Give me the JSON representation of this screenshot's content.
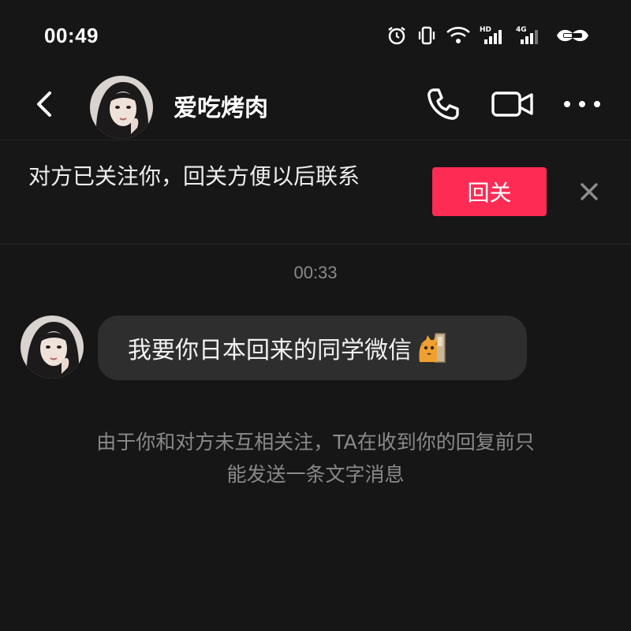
{
  "status": {
    "time": "00:49",
    "icons": [
      "alarm-icon",
      "vibrate-icon",
      "wifi-icon",
      "hd-signal-icon",
      "4g-signal-icon",
      "battery-icon"
    ]
  },
  "header": {
    "contact_name": "爱吃烤肉",
    "back_icon": "chevron-left-icon",
    "call_icon": "phone-icon",
    "video_icon": "video-camera-icon",
    "more_icon": "more-dots-icon"
  },
  "follow_banner": {
    "text": "对方已关注你，回关方便以后联系",
    "button_label": "回关",
    "button_color": "#fe2c55",
    "close_icon": "close-icon"
  },
  "conversation": {
    "timestamp": "00:33",
    "messages": [
      {
        "sender": "contact",
        "text": "我要你日本回来的同学微信",
        "emoji": "cat-peeking-emoji"
      }
    ],
    "notice": "由于你和对方未互相关注，TA在收到你的回复前只能发送一条文字消息"
  },
  "colors": {
    "background": "#161616",
    "bubble": "#2e2e2e",
    "muted_text": "#8a8a8a",
    "accent": "#fe2c55"
  }
}
